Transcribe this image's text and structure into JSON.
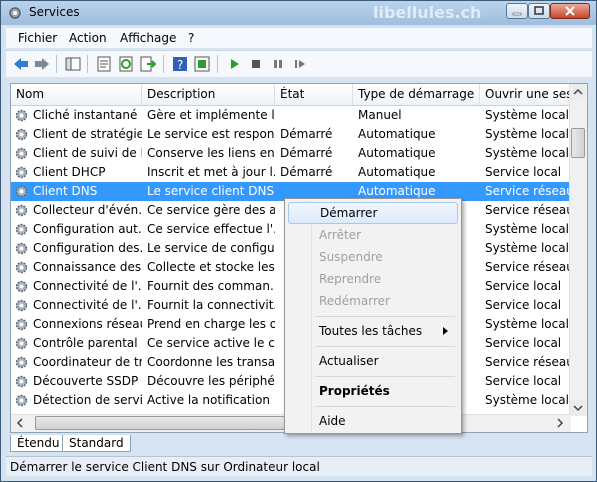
{
  "window": {
    "title": "Services",
    "watermark": "libellules.ch"
  },
  "menu": [
    "Fichier",
    "Action",
    "Affichage",
    "?"
  ],
  "columns": [
    "Nom",
    "Description",
    "État",
    "Type de démarrage",
    "Ouvrir une sessi"
  ],
  "rows": [
    [
      "Cliché instantané ...",
      "Gère et implémente l...",
      "",
      "Manuel",
      "Système local"
    ],
    [
      "Client de stratégie...",
      "Le service est respons...",
      "Démarré",
      "Automatique",
      "Système local"
    ],
    [
      "Client de suivi de l...",
      "Conserve les liens ent...",
      "Démarré",
      "Automatique",
      "Système local"
    ],
    [
      "Client DHCP",
      "Inscrit et met à jour l...",
      "Démarré",
      "Automatique",
      "Service local"
    ],
    [
      "Client DNS",
      "Le service client DNS ...",
      "",
      "Automatique",
      "Service réseau"
    ],
    [
      "Collecteur d'évén...",
      "Ce service gère des a...",
      "",
      "",
      "Service réseau"
    ],
    [
      "Configuration aut...",
      "Ce service effectue l'...",
      "",
      "",
      "Système local"
    ],
    [
      "Configuration des...",
      "Le service de configu...",
      "",
      "",
      "Système local"
    ],
    [
      "Connaissance des ...",
      "Collecte et stocke les ...",
      "",
      "",
      "Service réseau"
    ],
    [
      "Connectivité de l'...",
      "Fournit des comman...",
      "",
      "",
      "Service local"
    ],
    [
      "Connectivité de l'...",
      "Fournit la connectivit...",
      "",
      "",
      "Service local"
    ],
    [
      "Connexions réseau",
      "Prend en charge les o...",
      "",
      "",
      "Système local"
    ],
    [
      "Contrôle parental",
      "Ce service active le c...",
      "",
      "",
      "Service local"
    ],
    [
      "Coordinateur de tr...",
      "Coordonne les transa...",
      "",
      "",
      "Service réseau"
    ],
    [
      "Découverte SSDP",
      "Découvre les périphé...",
      "",
      "",
      "Service local"
    ],
    [
      "Détection de servi...",
      "Active la notification ...",
      "",
      "",
      "Système local"
    ]
  ],
  "selected_row": 4,
  "context_menu": {
    "start": "Démarrer",
    "stop": "Arrêter",
    "pause": "Suspendre",
    "resume": "Reprendre",
    "restart": "Redémarrer",
    "all_tasks": "Toutes les tâches",
    "refresh": "Actualiser",
    "properties": "Propriétés",
    "help": "Aide"
  },
  "tabs": [
    "Étendu",
    "Standard"
  ],
  "status": "Démarrer le service Client DNS sur Ordinateur local",
  "colors": {
    "selection": "#3399ff",
    "frame": "#d6e4f1",
    "play": "#2aa02a"
  },
  "icons": [
    "services-icon",
    "minimize-icon",
    "maximize-icon",
    "close-icon",
    "back-icon",
    "forward-icon",
    "gear-icon",
    "play-icon",
    "stop-icon",
    "pause-icon",
    "restart-icon",
    "help-icon"
  ]
}
